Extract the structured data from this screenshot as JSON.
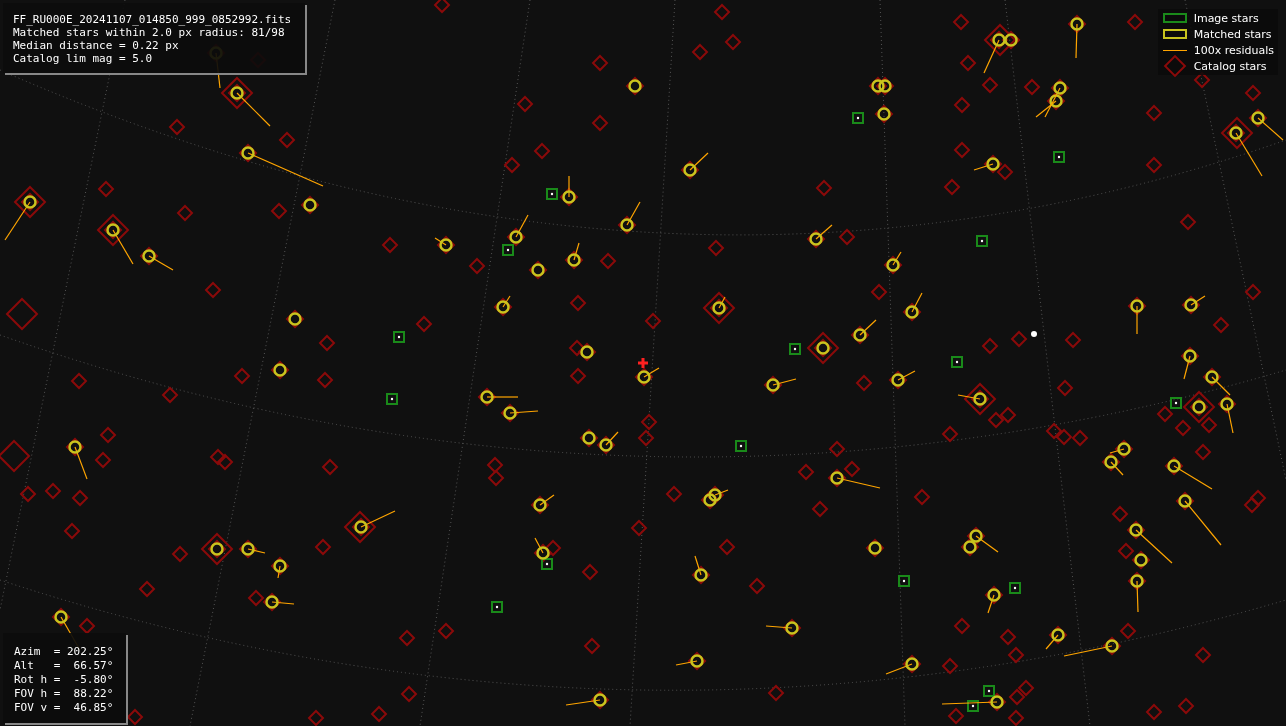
{
  "info_box": {
    "lines": [
      "FF_RU000E_20241107_014850_999_0852992.fits",
      "Matched stars within 2.0 px radius: 81/98",
      "Median distance = 0.22 px",
      "Catalog lim mag = 5.0"
    ]
  },
  "legend": [
    {
      "kind": "image",
      "label": "Image stars"
    },
    {
      "kind": "matched",
      "label": "Matched stars"
    },
    {
      "kind": "residual",
      "label": "100x residuals"
    },
    {
      "kind": "catalog",
      "label": "Catalog stars"
    }
  ],
  "pointing": {
    "lines": [
      "Azim  = 202.25°",
      "Alt   =  66.57°",
      "Rot h =  -5.80°",
      "FOV h =  88.22°",
      "FOV v =  46.85°"
    ]
  }
}
